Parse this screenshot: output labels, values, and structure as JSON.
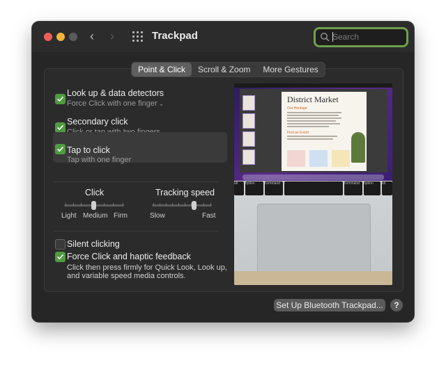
{
  "window": {
    "title": "Trackpad"
  },
  "search": {
    "placeholder": "Search",
    "value": ""
  },
  "tabs": [
    {
      "label": "Point & Click",
      "active": true
    },
    {
      "label": "Scroll & Zoom",
      "active": false
    },
    {
      "label": "More Gestures",
      "active": false
    }
  ],
  "options": [
    {
      "title": "Look up & data detectors",
      "subtitle": "Force Click with one finger",
      "checked": true,
      "has_dropdown": true
    },
    {
      "title": "Secondary click",
      "subtitle": "Click or tap with two fingers",
      "checked": true,
      "has_dropdown": true
    },
    {
      "title": "Tap to click",
      "subtitle": "Tap with one finger",
      "checked": true,
      "has_dropdown": false
    }
  ],
  "click_slider": {
    "title": "Click",
    "labels": [
      "Light",
      "Medium",
      "Firm"
    ],
    "value": "Medium"
  },
  "tracking_slider": {
    "title": "Tracking speed",
    "labels": [
      "Slow",
      "Fast"
    ],
    "value_fraction": 0.7
  },
  "silent_clicking": {
    "label": "Silent clicking",
    "checked": false
  },
  "force_click": {
    "label": "Force Click and haptic feedback",
    "checked": true,
    "description_line1": "Click then press firmly for Quick Look, Look up,",
    "description_line2": "and variable speed media controls."
  },
  "preview": {
    "doc_title": "District Market",
    "heading1": "Our Heritage",
    "heading2": "Find an Event",
    "keys": [
      "alt",
      "option",
      "command",
      "command",
      "option",
      "alt"
    ]
  },
  "footer": {
    "bluetooth_button": "Set Up Bluetooth Trackpad...",
    "help": "?"
  },
  "colors": {
    "accent_green": "#4f9b40",
    "search_focus": "#6f9f4c",
    "window_bg": "#262626"
  }
}
